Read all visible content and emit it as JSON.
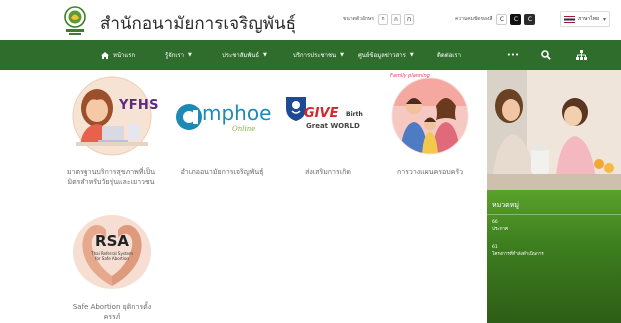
{
  "header": {
    "site_title": "สำนักอนามัยการเจริญพันธุ์",
    "font_size_label": "ขนาดตัวอักษร",
    "font_sizes": [
      "ก",
      "ก",
      "ก"
    ],
    "contrast_label": "ความคมชัดของสี",
    "contrast_options": [
      "C",
      "C",
      "C"
    ],
    "language": "ภาษาไทย"
  },
  "nav": {
    "items": [
      {
        "label": "หน้าแรก",
        "has_dropdown": false
      },
      {
        "label": "รู้จักเรา",
        "has_dropdown": true
      },
      {
        "label": "ประชาสัมพันธ์",
        "has_dropdown": true
      },
      {
        "label": "บริการประชาชน",
        "has_dropdown": true
      },
      {
        "label": "ศูนย์ข้อมูลข่าวสาร",
        "has_dropdown": true
      },
      {
        "label": "ติดต่อเรา",
        "has_dropdown": false
      }
    ],
    "more": "•••"
  },
  "cards": [
    {
      "logo_text": "YFHS",
      "caption": [
        "มาตรฐานบริการสุขภาพที่เป็น",
        "มิตรสำหรับวัยรุ่นและเยาวชน"
      ]
    },
    {
      "logo_text": "mphoe",
      "logo_sub": "Online",
      "caption": [
        "อำเภออนามัยการเจริญพันธุ์"
      ]
    },
    {
      "logo_give": "GIVE",
      "logo_birth": "Birth",
      "logo_great": "Great WORLD",
      "caption": [
        "ส่งเสริมการเกิด"
      ]
    },
    {
      "logo_text": "Family planning",
      "caption": [
        "การวางแผนครอบครัว"
      ]
    },
    {
      "logo_text": "RSA",
      "logo_sub": "Thai Referral System for Safe Abortion",
      "caption": [
        "Safe Abortion ยุติการตั้ง",
        "ครรภ์"
      ]
    }
  ],
  "sidebar": {
    "panel_title": "หมวดหมู่",
    "news": [
      {
        "num": "66",
        "text": "ประกาศ"
      },
      {
        "num": "61",
        "text": "โครงการที่กำลังดำเนินการ"
      }
    ]
  },
  "colors": {
    "nav_green": "#2e6d2b",
    "panel_green": "#4e8f22",
    "yfhs_purple": "#5b2a86",
    "amphoe_teal": "#1d8ab5",
    "give_red": "#d8252b",
    "rsa_dark": "#222222"
  }
}
